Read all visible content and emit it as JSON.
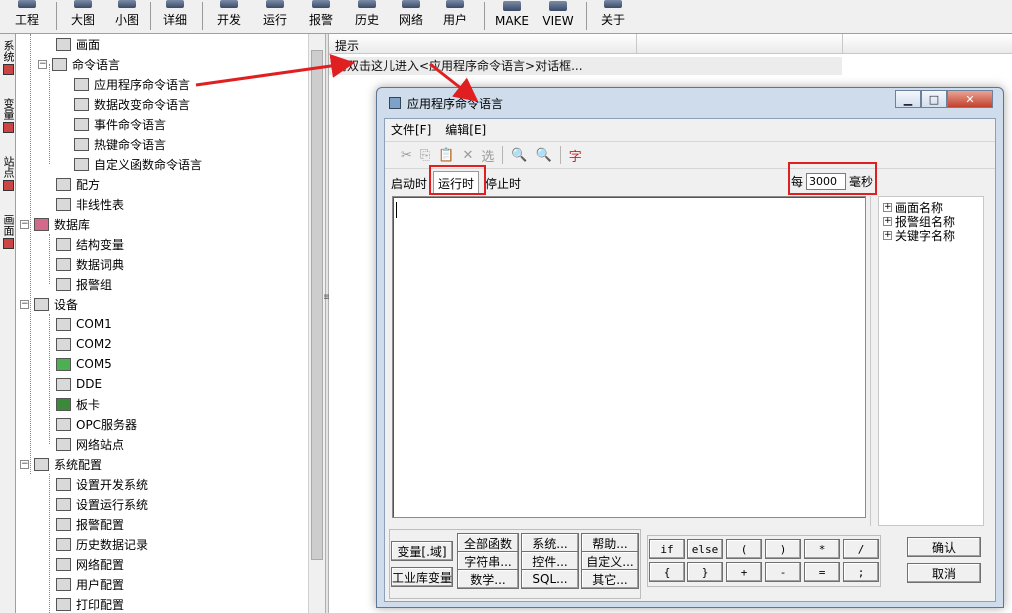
{
  "toolbar": {
    "items": [
      "工程",
      "大图",
      "小图",
      "详细",
      "开发",
      "运行",
      "报警",
      "历史",
      "网络",
      "用户",
      "MAKE",
      "VIEW",
      "关于"
    ]
  },
  "left_tabs": [
    "系统",
    "变量",
    "站点",
    "画面"
  ],
  "tree": {
    "items": [
      {
        "label": "画面"
      },
      {
        "label": "命令语言"
      },
      {
        "label": "应用程序命令语言"
      },
      {
        "label": "数据改变命令语言"
      },
      {
        "label": "事件命令语言"
      },
      {
        "label": "热键命令语言"
      },
      {
        "label": "自定义函数命令语言"
      },
      {
        "label": "配方"
      },
      {
        "label": "非线性表"
      },
      {
        "label": "数据库"
      },
      {
        "label": "结构变量"
      },
      {
        "label": "数据词典"
      },
      {
        "label": "报警组"
      },
      {
        "label": "设备"
      },
      {
        "label": "COM1"
      },
      {
        "label": "COM2"
      },
      {
        "label": "COM5"
      },
      {
        "label": "DDE"
      },
      {
        "label": "板卡"
      },
      {
        "label": "OPC服务器"
      },
      {
        "label": "网络站点"
      },
      {
        "label": "系统配置"
      },
      {
        "label": "设置开发系统"
      },
      {
        "label": "设置运行系统"
      },
      {
        "label": "报警配置"
      },
      {
        "label": "历史数据记录"
      },
      {
        "label": "网络配置"
      },
      {
        "label": "用户配置"
      },
      {
        "label": "打印配置"
      }
    ]
  },
  "list": {
    "header": "提示",
    "hint": "请双击这儿进入<应用程序命令语言>对话框..."
  },
  "dialog": {
    "title": "应用程序命令语言",
    "menu": [
      "文件[F]",
      "编辑[E]"
    ],
    "toolbar": [
      "✂",
      "⎘",
      "📋",
      "✕",
      "选",
      "🔍",
      "🔍",
      "字"
    ],
    "tabs": [
      "启动时",
      "运行时",
      "停止时"
    ],
    "period": {
      "prefix": "每",
      "value": "3000",
      "unit": "毫秒"
    },
    "editor_text": "",
    "side_tree": [
      "画面名称",
      "报警组名称",
      "关键字名称"
    ],
    "buttons": {
      "var": "变量[.域]",
      "lib": "工业库变量",
      "all_func": "全部函数",
      "string": "字符串...",
      "math": "数学...",
      "system": "系统...",
      "control": "控件...",
      "sql": "SQL...",
      "help": "帮助...",
      "custom": "自定义...",
      "other": "其它...",
      "ok": "确认",
      "cancel": "取消"
    },
    "operators": [
      "if",
      "else",
      "(",
      ")",
      "*",
      "/",
      "{",
      "}",
      "+",
      "-",
      "=",
      ";"
    ]
  },
  "colors": {
    "annotation": "#e02020"
  }
}
